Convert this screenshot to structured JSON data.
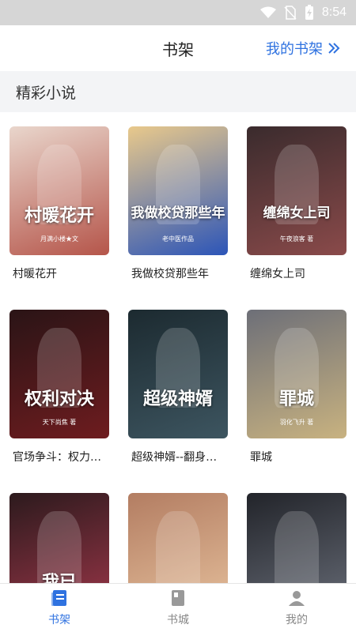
{
  "status": {
    "time": "8:54"
  },
  "header": {
    "title": "书架",
    "my_books_label": "我的书架",
    "my_books_icon": "double-chevron-right-icon"
  },
  "section": {
    "title": "精彩小说"
  },
  "books": [
    {
      "title": "村暖花开",
      "cover_text": "村暖花开",
      "cover_sub": "月满小楼★文",
      "colors": [
        "#e9d6cc",
        "#b5554a"
      ]
    },
    {
      "title": "我做校贷那些年",
      "cover_text": "我做校贷那些年",
      "cover_sub": "老中医作品",
      "colors": [
        "#e9c98b",
        "#2c55b8"
      ]
    },
    {
      "title": "缠绵女上司",
      "cover_text": "缠绵女上司",
      "cover_sub": "午夜浪客 著",
      "colors": [
        "#3a2b2d",
        "#8a4a4a"
      ]
    },
    {
      "title": "官场争斗：权力…",
      "cover_text": "权利对决",
      "cover_sub": "天下尚焦 著",
      "colors": [
        "#2a1416",
        "#6e1c1f"
      ]
    },
    {
      "title": "超级神婿--翻身…",
      "cover_text": "超级神婿",
      "cover_sub": "",
      "colors": [
        "#1c2a30",
        "#3d5560"
      ]
    },
    {
      "title": "罪城",
      "cover_text": "罪城",
      "cover_sub": "羽化飞升 著",
      "colors": [
        "#6d6f78",
        "#c8b280"
      ]
    },
    {
      "title": "",
      "cover_text": "我已",
      "cover_sub": "",
      "colors": [
        "#2c1a1d",
        "#a0374a"
      ]
    },
    {
      "title": "",
      "cover_text": "",
      "cover_sub": "",
      "colors": [
        "#b37d62",
        "#e7c29e"
      ]
    },
    {
      "title": "",
      "cover_text": "",
      "cover_sub": "",
      "colors": [
        "#22242a",
        "#6a6f7a"
      ]
    }
  ],
  "tabs": [
    {
      "label": "书架",
      "icon": "bookshelf-icon",
      "active": true
    },
    {
      "label": "书城",
      "icon": "book-store-icon",
      "active": false
    },
    {
      "label": "我的",
      "icon": "profile-icon",
      "active": false
    }
  ],
  "colors": {
    "accent": "#2f72e0",
    "section_bg": "#f3f4f6",
    "status_bar": "#d6d6d6"
  }
}
